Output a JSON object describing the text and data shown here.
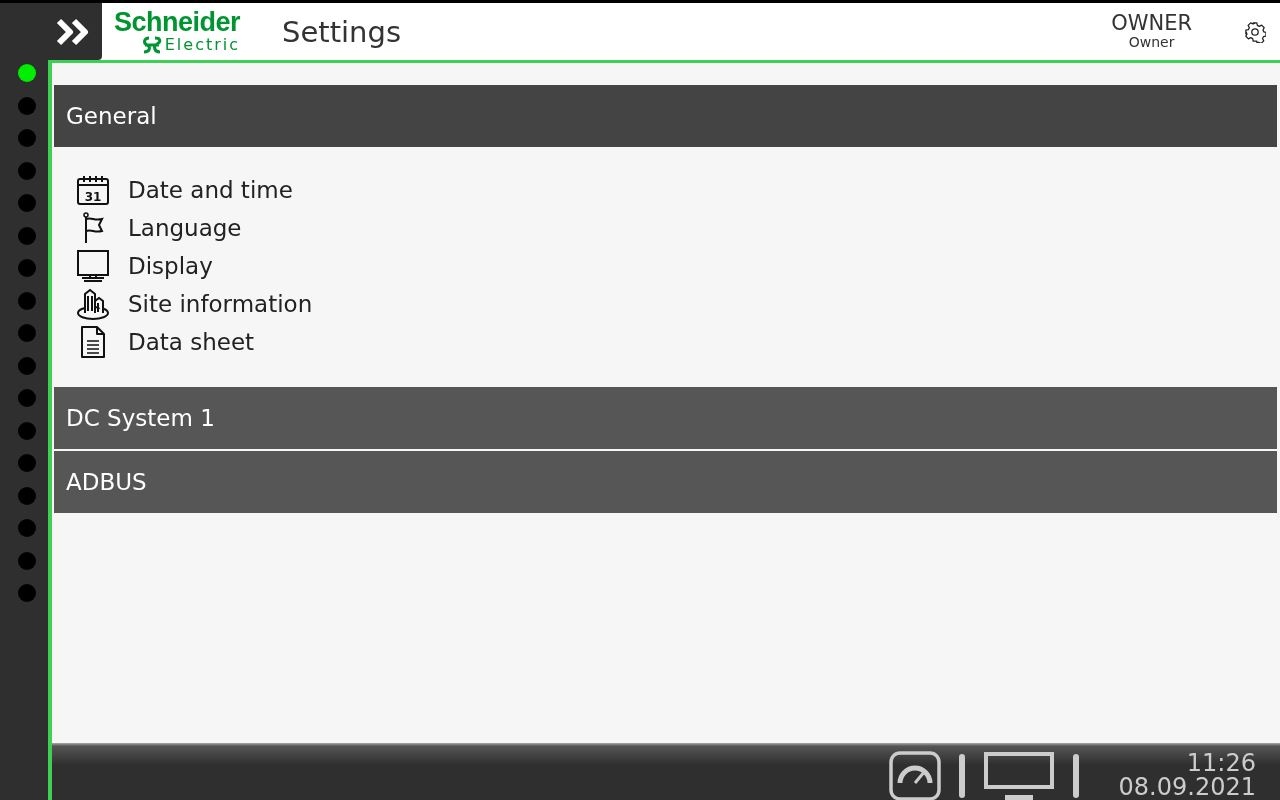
{
  "header": {
    "logo": {
      "name": "Schneider",
      "sub": "Electric"
    },
    "title": "Settings",
    "user": {
      "role": "OWNER",
      "name": "Owner"
    }
  },
  "status_dots": [
    {
      "color": "#00ee00"
    },
    {
      "color": "#000000"
    },
    {
      "color": "#000000"
    },
    {
      "color": "#000000"
    },
    {
      "color": "#000000"
    },
    {
      "color": "#000000"
    },
    {
      "color": "#000000"
    },
    {
      "color": "#000000"
    },
    {
      "color": "#000000"
    },
    {
      "color": "#000000"
    },
    {
      "color": "#000000"
    },
    {
      "color": "#000000"
    },
    {
      "color": "#000000"
    },
    {
      "color": "#000000"
    },
    {
      "color": "#000000"
    },
    {
      "color": "#000000"
    },
    {
      "color": "#000000"
    }
  ],
  "sections": [
    {
      "title": "General",
      "expanded": true,
      "items": [
        {
          "kind": "calendar",
          "icon_text": "31",
          "label": "Date and time"
        },
        {
          "kind": "flag",
          "label": "Language"
        },
        {
          "kind": "monitor",
          "label": "Display"
        },
        {
          "kind": "building",
          "label": "Site information"
        },
        {
          "kind": "document",
          "label": "Data sheet"
        }
      ]
    },
    {
      "title": "DC System 1",
      "expanded": false
    },
    {
      "title": "ADBUS",
      "expanded": false
    }
  ],
  "status_bar": {
    "time": "11:26",
    "date": "08.09.2021"
  }
}
